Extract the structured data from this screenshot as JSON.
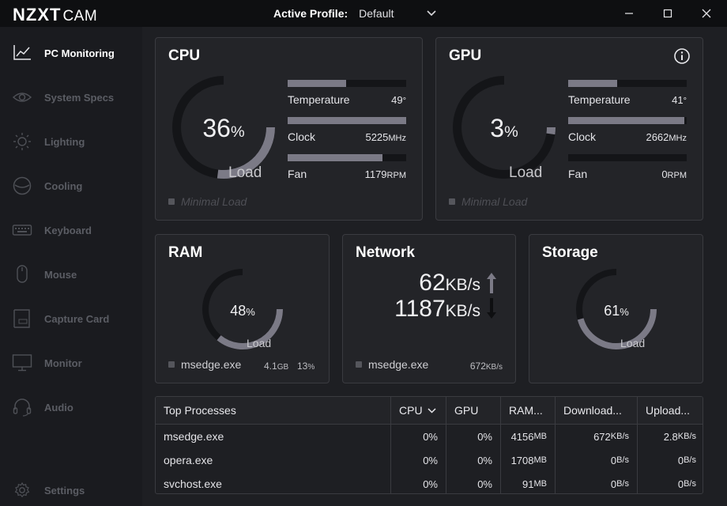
{
  "app": {
    "logo_brand": "NZXT",
    "logo_product": "CAM",
    "profile_label": "Active Profile:",
    "profile_value": "Default"
  },
  "sidebar": {
    "items": [
      {
        "label": "PC Monitoring",
        "icon": "chart-line-icon",
        "active": true
      },
      {
        "label": "System Specs",
        "icon": "eye-icon",
        "active": false
      },
      {
        "label": "Lighting",
        "icon": "sun-icon",
        "active": false
      },
      {
        "label": "Cooling",
        "icon": "fan-icon",
        "active": false
      },
      {
        "label": "Keyboard",
        "icon": "keyboard-icon",
        "active": false
      },
      {
        "label": "Mouse",
        "icon": "mouse-icon",
        "active": false
      },
      {
        "label": "Capture Card",
        "icon": "capture-card-icon",
        "active": false
      },
      {
        "label": "Monitor",
        "icon": "monitor-icon",
        "active": false
      },
      {
        "label": "Audio",
        "icon": "headset-icon",
        "active": false
      }
    ],
    "settings_label": "Settings"
  },
  "cpu": {
    "title": "CPU",
    "load_value": "36",
    "load_unit": "%",
    "load_label": "Load",
    "load_fraction": 0.36,
    "stats": [
      {
        "name": "Temperature",
        "value": "49",
        "unit": "°",
        "fraction": 0.49
      },
      {
        "name": "Clock",
        "value": "5225",
        "unit": "MHz",
        "fraction": 1.0
      },
      {
        "name": "Fan",
        "value": "1179",
        "unit": "RPM",
        "fraction": 0.8
      }
    ],
    "status": "Minimal Load"
  },
  "gpu": {
    "title": "GPU",
    "load_value": "3",
    "load_unit": "%",
    "load_label": "Load",
    "load_fraction": 0.03,
    "stats": [
      {
        "name": "Temperature",
        "value": "41",
        "unit": "°",
        "fraction": 0.41
      },
      {
        "name": "Clock",
        "value": "2662",
        "unit": "MHz",
        "fraction": 0.98
      },
      {
        "name": "Fan",
        "value": "0",
        "unit": "RPM",
        "fraction": 0.0
      }
    ],
    "status": "Minimal Load"
  },
  "ram": {
    "title": "RAM",
    "load_value": "48",
    "load_unit": "%",
    "load_label": "Load",
    "load_fraction": 0.48,
    "top_process": "msedge.exe",
    "process_amount": "4.1",
    "process_amount_unit": "GB",
    "process_percent": "13",
    "process_percent_unit": "%"
  },
  "network": {
    "title": "Network",
    "upload_value": "62",
    "download_value": "1187",
    "unit": "KB/s",
    "top_process": "msedge.exe",
    "process_rate": "672",
    "process_rate_unit": "KB/s"
  },
  "storage": {
    "title": "Storage",
    "load_value": "61",
    "load_unit": "%",
    "load_label": "Load",
    "load_fraction": 0.61
  },
  "processes": {
    "headers": [
      "Top Processes",
      "CPU",
      "GPU",
      "RAM...",
      "Download...",
      "Upload..."
    ],
    "rows": [
      {
        "name": "msedge.exe",
        "cpu": "0%",
        "gpu": "0%",
        "ram": "4156",
        "ram_unit": "MB",
        "down": "672",
        "down_unit": "KB/s",
        "up": "2.8",
        "up_unit": "KB/s"
      },
      {
        "name": "opera.exe",
        "cpu": "0%",
        "gpu": "0%",
        "ram": "1708",
        "ram_unit": "MB",
        "down": "0",
        "down_unit": "B/s",
        "up": "0",
        "up_unit": "B/s"
      },
      {
        "name": "svchost.exe",
        "cpu": "0%",
        "gpu": "0%",
        "ram": "91",
        "ram_unit": "MB",
        "down": "0",
        "down_unit": "B/s",
        "up": "0",
        "up_unit": "B/s"
      }
    ]
  },
  "colors": {
    "accent_fill": "#7b7a86",
    "track": "#141518",
    "card_bg": "#232428",
    "border": "#3a3b40"
  }
}
